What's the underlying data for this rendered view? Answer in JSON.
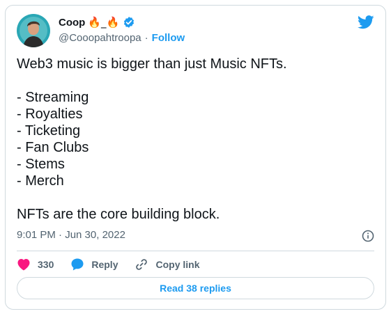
{
  "author": {
    "display_name": "Coop",
    "name_decoration": "🔥_🔥",
    "handle": "@Cooopahtroopa",
    "separator": "·",
    "follow_label": "Follow",
    "verified": true
  },
  "tweet": {
    "text": "Web3 music is bigger than just Music NFTs.\n\n- Streaming\n- Royalties\n- Ticketing\n- Fan Clubs\n- Stems\n- Merch\n\nNFTs are the core building block.",
    "timestamp": "9:01 PM · Jun 30, 2022"
  },
  "actions": {
    "like_count": "330",
    "reply_label": "Reply",
    "copy_link_label": "Copy link"
  },
  "footer": {
    "read_replies_label": "Read 38 replies"
  },
  "colors": {
    "accent": "#1d9bf0",
    "like": "#f91880",
    "text": "#0f1419",
    "secondary_text": "#536471",
    "border": "#cfd9de"
  },
  "icons": {
    "brand": "twitter-bird-icon",
    "verified": "verified-badge-icon",
    "info": "info-icon",
    "like": "heart-icon",
    "reply": "speech-bubble-icon",
    "copy_link": "link-icon"
  }
}
